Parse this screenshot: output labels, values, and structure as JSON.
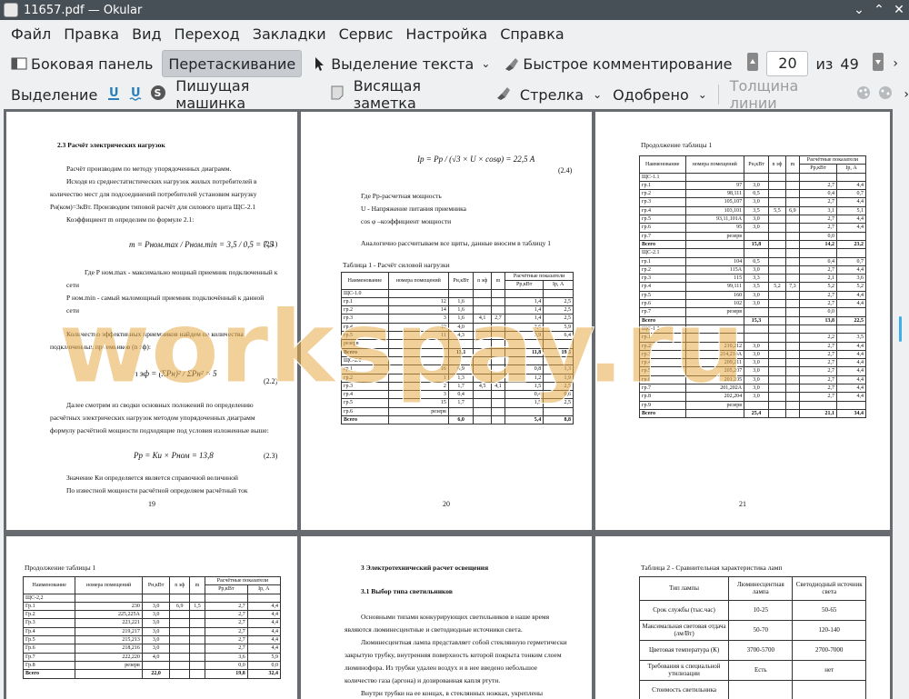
{
  "window": {
    "title": "11657.pdf — Okular"
  },
  "menu": [
    "Файл",
    "Правка",
    "Вид",
    "Переход",
    "Закладки",
    "Сервис",
    "Настройка",
    "Справка"
  ],
  "toolbar1": {
    "sidebar": "Боковая панель",
    "drag": "Перетаскивание",
    "select_text": "Выделение текста",
    "quick_comment": "Быстрое комментирование",
    "page": "20",
    "of": "из",
    "total": "49"
  },
  "toolbar2": {
    "selection": "Выделение",
    "typewriter": "Пишущая машинка",
    "note": "Висящая заметка",
    "arrow": "Стрелка",
    "approved": "Одобрено",
    "line_width": "Толщина линии"
  },
  "watermark": "workspay.ru",
  "pages": {
    "p19": {
      "heading": "2.3 Расчёт электрических нагрузок",
      "num": "19",
      "lines": [
        "Расчёт производим по методу упорядоченных диаграмм.",
        "Исходя из среднестатистических нагрузок жилых потребителей в",
        "количество мест для подсоединений потребителей установим нагрузку",
        "Рн(ком)=3кВт. Производим типовой расчёт для силового щита ЩС-2.1",
        "Коэффициент m определим по формуле 2.1:"
      ],
      "f1": "m = Pном.max / Pном.min = 3,5 / 0,5 = 7,5",
      "f1n": "(2.1)",
      "lines2": [
        "Где Р ном.max - максимально мощный приемник подключенный к",
        "сети",
        "Р ном.min - самый маломощный приемник подключённый к данной",
        "сети"
      ],
      "lines3": [
        "Количество эффективных приемников найдем по количества",
        "подключенных приемников (n эф):"
      ],
      "f2": "n эф = (ΣPн)² / ΣPн² = 5",
      "f2n": "(2.2)",
      "lines4": [
        "Далее смотрим из сводки основных положений по определению",
        "расчётных электрических нагрузок методом упорядоченных диаграмм",
        "формулу расчётной мощности подходящие под условия изложенные выше:"
      ],
      "f3": "Pp = Ки × Pном = 13,8",
      "f3n": "(2.3)",
      "lines5": [
        "Значение Ки определяется является справочной величиной",
        "По известной мощности расчётной определяем расчётный ток"
      ]
    },
    "p20": {
      "num": "20",
      "f4": "Iр = Pр / (√3 × U × cosφ) = 22,5 А",
      "f4n": "(2.4)",
      "lines": [
        "Где Рр-расчетная мощность",
        "U - Напряжение питания приемника",
        "cos φ –коэффициент мощности"
      ],
      "line2": "Аналогично рассчитываем  все щиты, данные вносим в таблицу 1",
      "tcap": "Таблица 1 - Расчёт силовой нагрузки",
      "h": [
        "Наименование",
        "номера помещений",
        "Рн,кВт",
        "n эф",
        "m",
        "Расчётные показатели",
        "Рр,кВт",
        "Iр, А"
      ],
      "rows": [
        [
          "ЩС-1.0",
          "",
          "",
          "",
          "",
          "",
          ""
        ],
        [
          "гр.1",
          "12",
          "1,6",
          "",
          "",
          "1,4",
          "2,5"
        ],
        [
          "гр.2",
          "14",
          "1,6",
          "",
          "",
          "1,4",
          "2,5"
        ],
        [
          "гр.3",
          "3",
          "1,6",
          "4,1",
          "2,7",
          "1,4",
          "2,5"
        ],
        [
          "гр.4",
          "10",
          "4,0",
          "",
          "",
          "3,6",
          "5,9"
        ],
        [
          "гр.5",
          "11",
          "4,3",
          "",
          "",
          "3,9",
          "6,4"
        ],
        [
          "резерв",
          "",
          "",
          "",
          "",
          "",
          ""
        ],
        [
          "Всего",
          "",
          "13,1",
          "",
          "",
          "11,8",
          "19,5"
        ],
        [
          "ЩС-2.0",
          "",
          "",
          "",
          "",
          "",
          ""
        ],
        [
          "гр.1",
          "16",
          "0,9",
          "",
          "",
          "0,8",
          "1,3"
        ],
        [
          "гр.2",
          "1",
          "1,3",
          "",
          "",
          "1,2",
          "1,9"
        ],
        [
          "гр.3",
          "2",
          "1,7",
          "4,5",
          "4,1",
          "1,5",
          "2,5"
        ],
        [
          "гр.4",
          "3",
          "0,4",
          "",
          "",
          "0,4",
          "0,6"
        ],
        [
          "гр.5",
          "15",
          "1,7",
          "",
          "",
          "1,5",
          "2,5"
        ],
        [
          "гр.6",
          "резерв",
          "",
          "",
          "",
          "",
          ""
        ],
        [
          "Всего",
          "",
          "6,0",
          "",
          "",
          "5,4",
          "8,8"
        ]
      ]
    },
    "p21": {
      "num": "21",
      "tcap": "Продолжение таблицы 1",
      "h": [
        "Наименование",
        "номера помещений",
        "Рн,кВт",
        "n эф",
        "m",
        "Расчётные показатели",
        "Рр,кВт",
        "Iр, А"
      ],
      "rows": [
        [
          "ЩС-1.1",
          "",
          "",
          "",
          "",
          "",
          ""
        ],
        [
          "гр.1",
          "97",
          "3,0",
          "",
          "",
          "2,7",
          "4,4"
        ],
        [
          "гр.2",
          "98,111",
          "0,5",
          "",
          "",
          "0,4",
          "0,7"
        ],
        [
          "гр.3",
          "105,107",
          "3,0",
          "",
          "",
          "2,7",
          "4,4"
        ],
        [
          "гр.4",
          "103,101",
          "3,5",
          "5,5",
          "6,9",
          "3,1",
          "5,1"
        ],
        [
          "гр.5",
          "93,11,101А",
          "3,0",
          "",
          "",
          "2,7",
          "4,4"
        ],
        [
          "гр.6",
          "95",
          "3,0",
          "",
          "",
          "2,7",
          "4,4"
        ],
        [
          "гр.7",
          "резерв",
          "",
          "",
          "",
          "0,0",
          ""
        ],
        [
          "Всего",
          "",
          "15,8",
          "",
          "",
          "14,2",
          "23,2"
        ],
        [
          "ЩС-2.1",
          "",
          "",
          "",
          "",
          "",
          ""
        ],
        [
          "гр.1",
          "104",
          "0,5",
          "",
          "",
          "0,4",
          "0,7"
        ],
        [
          "гр.2",
          "115А",
          "3,0",
          "",
          "",
          "2,7",
          "4,4"
        ],
        [
          "гр.3",
          "115",
          "3,3",
          "",
          "",
          "2,1",
          "3,6"
        ],
        [
          "гр.4",
          "99,111",
          "3,5",
          "5,2",
          "7,3",
          "5,2",
          "5,2"
        ],
        [
          "гр.5",
          "160",
          "3,0",
          "",
          "",
          "2,7",
          "4,4"
        ],
        [
          "гр.6",
          "102",
          "3,0",
          "",
          "",
          "2,7",
          "4,4"
        ],
        [
          "гр.7",
          "резерв",
          "",
          "",
          "",
          "0,0",
          ""
        ],
        [
          "Всего",
          "",
          "15,3",
          "",
          "",
          "13,8",
          "22,5"
        ],
        [
          "ЩС-1.2",
          "",
          "",
          "",
          "",
          "",
          ""
        ],
        [
          "гр.1",
          "",
          "",
          "",
          "",
          "2,2",
          "3,5"
        ],
        [
          "гр.2",
          "210,212",
          "3,0",
          "",
          "",
          "2,7",
          "4,4"
        ],
        [
          "гр.3",
          "214,214А",
          "3,0",
          "",
          "",
          "2,7",
          "4,4"
        ],
        [
          "гр.4",
          "209,211",
          "3,0",
          "",
          "",
          "2,7",
          "4,4"
        ],
        [
          "гр.5",
          "205,207",
          "3,0",
          "",
          "",
          "2,7",
          "4,4"
        ],
        [
          "гр.6",
          "201,205",
          "3,0",
          "",
          "",
          "2,7",
          "4,4"
        ],
        [
          "гр.7",
          "201,202А",
          "3,0",
          "",
          "",
          "2,7",
          "4,4"
        ],
        [
          "гр.8",
          "202,204",
          "3,0",
          "",
          "",
          "2,7",
          "4,4"
        ],
        [
          "гр.9",
          "резерв",
          "",
          "",
          "",
          "",
          ""
        ],
        [
          "Всего",
          "",
          "25,4",
          "",
          "",
          "21,1",
          "34,4"
        ]
      ]
    },
    "p22": {
      "tcap": "Продолжение таблицы 1",
      "h": [
        "Наименование",
        "номера помещений",
        "Рн,кВт",
        "n эф",
        "m",
        "Расчётные показатели",
        "Рр,кВт",
        "Iр, А"
      ],
      "rows": [
        [
          "ЩС-2,2",
          "",
          "",
          "",
          "",
          "",
          ""
        ],
        [
          "Гр.1",
          "230",
          "3,0",
          "6,9",
          "1,5",
          "2,7",
          "4,4"
        ],
        [
          "Гр.2",
          "225,225А",
          "3,0",
          "",
          "",
          "2,7",
          "4,4"
        ],
        [
          "Гр.3",
          "223,221",
          "3,0",
          "",
          "",
          "2,7",
          "4,4"
        ],
        [
          "Гр.4",
          "219,217",
          "3,0",
          "",
          "",
          "2,7",
          "4,4"
        ],
        [
          "Гр.5",
          "215,213",
          "3,0",
          "",
          "",
          "2,7",
          "4,4"
        ],
        [
          "Гр.6",
          "218,216",
          "3,0",
          "",
          "",
          "2,7",
          "4,4"
        ],
        [
          "Гр.7",
          "222,220",
          "4,0",
          "",
          "",
          "3,6",
          "5,9"
        ],
        [
          "Гр.8",
          "резерв",
          "",
          "",
          "",
          "0,0",
          "0,0"
        ],
        [
          "Всего",
          "",
          "22,0",
          "",
          "",
          "19,8",
          "32,4"
        ]
      ]
    },
    "p23": {
      "h1": "3 Электротехнический расчет освещения",
      "h2": "3.1 Выбор типа светильников",
      "lines": [
        "Основными типами конкурирующих светильников в наше время",
        "являются люминесцентные и светодиодные источники света.",
        "Люминесцентная лампа представляет собой стеклянную герметически",
        "закрытую трубку, внутренняя поверхность которой покрыта тонким слоем",
        "люминофора. Из трубки удален воздух и в нее введено небольшое",
        "количество газа (аргона) и дозированная капля ртути.",
        "Внутри трубки на ее концах, в стеклянных ножках, укреплены"
      ]
    },
    "p24": {
      "tcap": "Таблица 2 - Сравнительная характеристика ламп",
      "h": [
        "Тип лампы",
        "Люминесцентная лампа",
        "Светодиодный источник света"
      ],
      "rows": [
        [
          "Срок службы (тыс.час)",
          "10-25",
          "50-65"
        ],
        [
          "Максимальная световая отдача (лм/Вт)",
          "50-70",
          "120-140"
        ],
        [
          "Цветовая температура (К)",
          "3700-5700",
          "2700-7000"
        ],
        [
          "Требования к специальной утилизации",
          "Есть",
          "нет"
        ],
        [
          "Стоимость светильника",
          "",
          ""
        ]
      ]
    }
  }
}
